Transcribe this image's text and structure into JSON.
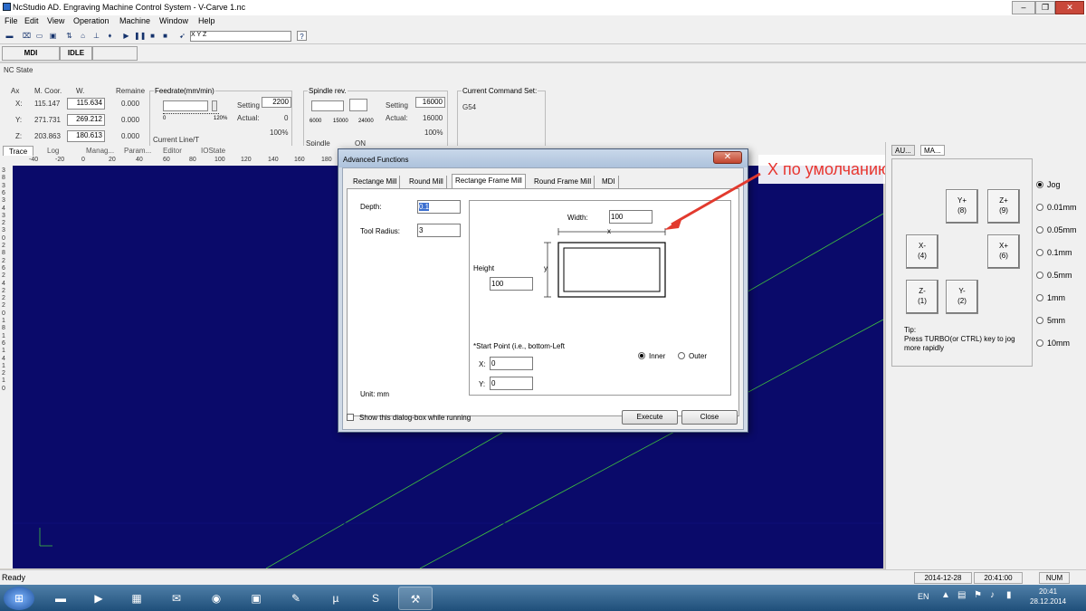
{
  "window": {
    "title": "NcStudio AD. Engraving Machine Control System  - V-Carve 1.nc",
    "minimize": "–",
    "maximize": "❐",
    "close": "✕"
  },
  "menu": [
    "File",
    "Edit",
    "View",
    "Operation",
    "Machine",
    "Window",
    "Help"
  ],
  "toolbar": {
    "coord_text": "X         Y         Z"
  },
  "mode": {
    "mode": "MDI",
    "state": "IDLE"
  },
  "nc_state": {
    "title": "NC State",
    "headers": {
      "axis": "Ax",
      "mcoor": "M. Coor.",
      "w": "W.",
      "remain": "Remaine"
    },
    "rows": [
      {
        "axis": "X:",
        "mcoor": "115.147",
        "w": "115.634",
        "remain": "0.000"
      },
      {
        "axis": "Y:",
        "mcoor": "271.731",
        "w": "269.212",
        "remain": "0.000"
      },
      {
        "axis": "Z:",
        "mcoor": "203.863",
        "w": "180.613",
        "remain": "0.000"
      }
    ],
    "feedrate": {
      "title": "Feedrate(mm/min)",
      "setting_label": "Setting",
      "setting_value": "2200",
      "actual_label": "Actual:",
      "actual_value": "0",
      "percent": "100%",
      "scale_min": "0",
      "scale_max": "120%",
      "current_line": "Current Line/T"
    },
    "spindle": {
      "title": "Spindle rev.",
      "setting_label": "Setting",
      "setting_value": "16000",
      "actual_label": "Actual:",
      "actual_value": "16000",
      "percent": "100%",
      "ticks": [
        "6000",
        "15000",
        "24000"
      ],
      "status_label": "Spindle",
      "status_value": "ON"
    },
    "command": {
      "title": "Current Command Set:",
      "value": "G54"
    }
  },
  "tabs": [
    "Trace",
    "Log",
    "Manag...",
    "Param...",
    "Editor",
    "IOState"
  ],
  "ruler_ticks": [
    "-40",
    "-20",
    "0",
    "20",
    "40",
    "60",
    "80",
    "100",
    "120",
    "140",
    "160",
    "180"
  ],
  "vruler_labels": [
    "3",
    "8",
    "3",
    "6",
    "3",
    "4",
    "3",
    "2",
    "3",
    "0",
    "2",
    "8",
    "2",
    "6",
    "2",
    "4",
    "2",
    "2",
    "2",
    "0",
    "1",
    "8",
    "1",
    "6",
    "1",
    "4",
    "1",
    "2",
    "1",
    "0"
  ],
  "dialog": {
    "title": "Advanced Functions",
    "tabs": [
      "Rectange Mill",
      "Round Mill",
      "Rectange Frame Mill",
      "Round Frame Mill",
      "MDI"
    ],
    "depth_label": "Depth:",
    "depth_value": "0.1",
    "radius_label": "Tool Radius:",
    "radius_value": "3",
    "width_label": "Width:",
    "width_value": "100",
    "height_label": "Height",
    "height_value": "100",
    "diagram_x": "x",
    "diagram_y": "y",
    "start_label": "*Start Point (i.e., bottom-Left",
    "start_x_label": "X:",
    "start_x_value": "0",
    "start_y_label": "Y:",
    "start_y_value": "0",
    "inner_label": "Inner",
    "outer_label": "Outer",
    "unit_label": "Unit: mm",
    "show_label": "Show this dialog-box while running",
    "execute": "Execute",
    "close": "Close"
  },
  "annotation": "X по умолчанию длинная ось!!!",
  "right_panel": {
    "tabs": [
      "AU...",
      "MA..."
    ],
    "jog_label": "Jog",
    "buttons": [
      {
        "label": "Y+",
        "key": "(8)"
      },
      {
        "label": "Z+",
        "key": "(9)"
      },
      {
        "label": "X-",
        "key": "(4)"
      },
      {
        "label": "X+",
        "key": "(6)"
      },
      {
        "label": "Z-",
        "key": "(1)"
      },
      {
        "label": "Y-",
        "key": "(2)"
      }
    ],
    "steps": [
      "Jog",
      "0.01mm",
      "0.05mm",
      "0.1mm",
      "0.5mm",
      "1mm",
      "5mm",
      "10mm"
    ],
    "tip": "Tip:\nPress TURBO(or CTRL) key to jog more rapidly"
  },
  "status": {
    "ready": "Ready",
    "date": "2014-12-28",
    "time": "20:41:00",
    "num": "NUM"
  },
  "taskbar": {
    "lang": "EN",
    "clock_time": "20:41",
    "clock_date": "28.12.2014"
  },
  "colors": {
    "canvas": "#0a0a6a",
    "annotation_text": "#e8352f",
    "arrow": "#e23a2e"
  }
}
